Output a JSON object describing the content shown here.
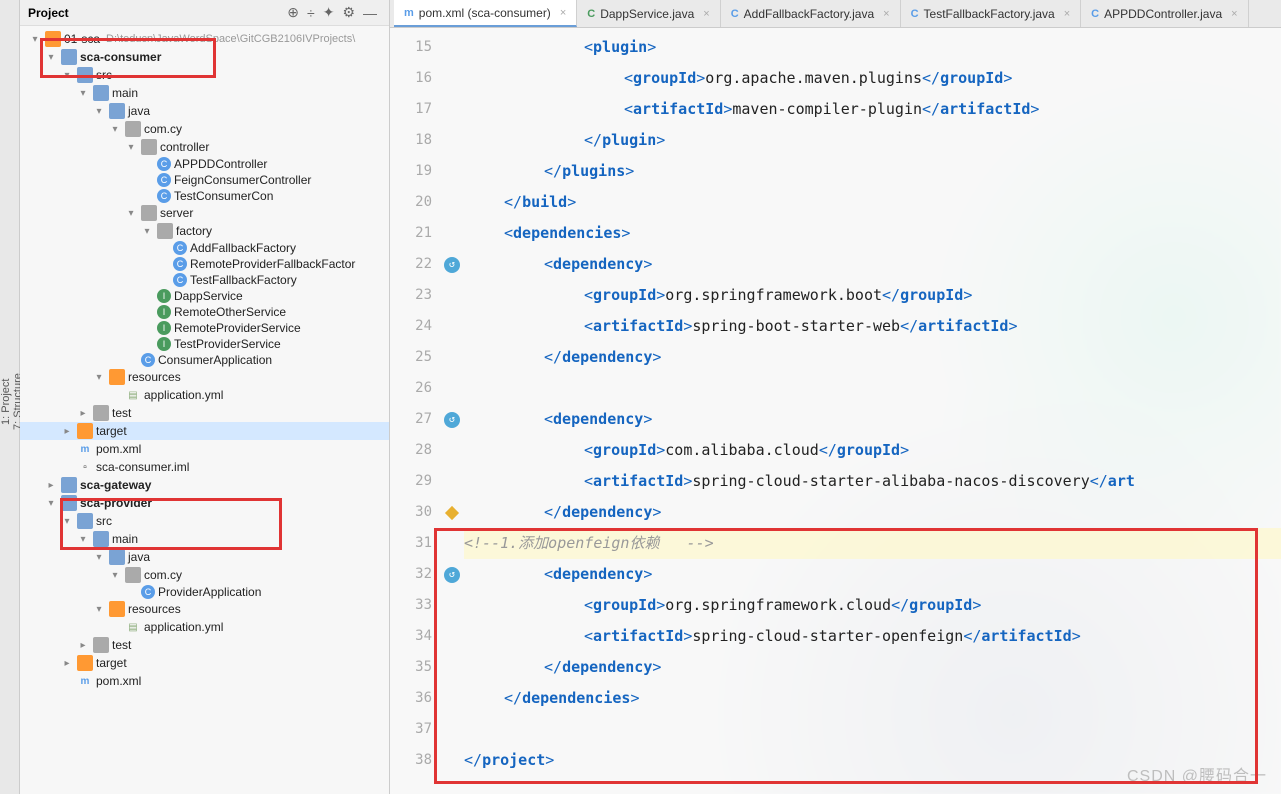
{
  "leftRail": {
    "project": "1: Project",
    "structure": "7: Structure"
  },
  "panel": {
    "title": "Project",
    "rootLabel": "01-sca",
    "rootPath": "D:\\teducn\\JavaWordSpace\\GitCGB2106IVProjects\\",
    "tree": {
      "sca_consumer": "sca-consumer",
      "src": "src",
      "main": "main",
      "java": "java",
      "com_cy": "com.cy",
      "controller": "controller",
      "appdd": "APPDDController",
      "feign": "FeignConsumerController",
      "testcon": "TestConsumerCon",
      "server": "server",
      "factory": "factory",
      "addfall": "AddFallbackFactory",
      "remotefall": "RemoteProviderFallbackFactor",
      "testfall": "TestFallbackFactory",
      "dapp": "DappService",
      "remoteother": "RemoteOtherService",
      "remoteprov": "RemoteProviderService",
      "testprov": "TestProviderService",
      "consumerapp": "ConsumerApplication",
      "resources": "resources",
      "appyml": "application.yml",
      "test": "test",
      "target": "target",
      "pomxml": "pom.xml",
      "scaiml": "sca-consumer.iml",
      "sca_gateway": "sca-gateway",
      "sca_provider": "sca-provider",
      "provapp": "ProviderApplication"
    }
  },
  "tabs": [
    {
      "icon": "m",
      "label": "pom.xml (sca-consumer)",
      "active": true,
      "iconColor": "#5a9de8"
    },
    {
      "icon": "C",
      "label": "DappService.java",
      "iconColor": "#4a9b5e"
    },
    {
      "icon": "C",
      "label": "AddFallbackFactory.java",
      "iconColor": "#5a9de8"
    },
    {
      "icon": "C",
      "label": "TestFallbackFactory.java",
      "iconColor": "#5a9de8"
    },
    {
      "icon": "C",
      "label": "APPDDController.java",
      "iconColor": "#5a9de8"
    }
  ],
  "code": {
    "startLine": 15,
    "lines": [
      {
        "n": 15,
        "indent": 12,
        "parts": [
          [
            "bracket",
            "<"
          ],
          [
            "tag",
            "plugin"
          ],
          [
            "bracket",
            ">"
          ]
        ]
      },
      {
        "n": 16,
        "indent": 16,
        "parts": [
          [
            "bracket",
            "<"
          ],
          [
            "tag",
            "groupId"
          ],
          [
            "bracket",
            ">"
          ],
          [
            "text",
            "org.apache.maven.plugins"
          ],
          [
            "bracket",
            "</"
          ],
          [
            "tag",
            "groupId"
          ],
          [
            "bracket",
            ">"
          ]
        ]
      },
      {
        "n": 17,
        "indent": 16,
        "parts": [
          [
            "bracket",
            "<"
          ],
          [
            "tag",
            "artifactId"
          ],
          [
            "bracket",
            ">"
          ],
          [
            "text",
            "maven-compiler-plugin"
          ],
          [
            "bracket",
            "</"
          ],
          [
            "tag",
            "artifactId"
          ],
          [
            "bracket",
            ">"
          ]
        ]
      },
      {
        "n": 18,
        "indent": 12,
        "parts": [
          [
            "bracket",
            "</"
          ],
          [
            "tag",
            "plugin"
          ],
          [
            "bracket",
            ">"
          ]
        ]
      },
      {
        "n": 19,
        "indent": 8,
        "parts": [
          [
            "bracket",
            "</"
          ],
          [
            "tag",
            "plugins"
          ],
          [
            "bracket",
            ">"
          ]
        ]
      },
      {
        "n": 20,
        "indent": 4,
        "parts": [
          [
            "bracket",
            "</"
          ],
          [
            "tag",
            "build"
          ],
          [
            "bracket",
            ">"
          ]
        ]
      },
      {
        "n": 21,
        "indent": 4,
        "parts": [
          [
            "bracket",
            "<"
          ],
          [
            "tag",
            "dependencies"
          ],
          [
            "bracket",
            ">"
          ]
        ]
      },
      {
        "n": 22,
        "indent": 8,
        "parts": [
          [
            "bracket",
            "<"
          ],
          [
            "tag",
            "dependency"
          ],
          [
            "bracket",
            ">"
          ]
        ],
        "gicon": "circle"
      },
      {
        "n": 23,
        "indent": 12,
        "parts": [
          [
            "bracket",
            "<"
          ],
          [
            "tag",
            "groupId"
          ],
          [
            "bracket",
            ">"
          ],
          [
            "text",
            "org.springframework.boot"
          ],
          [
            "bracket",
            "</"
          ],
          [
            "tag",
            "groupId"
          ],
          [
            "bracket",
            ">"
          ]
        ]
      },
      {
        "n": 24,
        "indent": 12,
        "parts": [
          [
            "bracket",
            "<"
          ],
          [
            "tag",
            "artifactId"
          ],
          [
            "bracket",
            ">"
          ],
          [
            "text",
            "spring-boot-starter-web"
          ],
          [
            "bracket",
            "</"
          ],
          [
            "tag",
            "artifactId"
          ],
          [
            "bracket",
            ">"
          ]
        ]
      },
      {
        "n": 25,
        "indent": 8,
        "parts": [
          [
            "bracket",
            "</"
          ],
          [
            "tag",
            "dependency"
          ],
          [
            "bracket",
            ">"
          ]
        ]
      },
      {
        "n": 26,
        "indent": 0,
        "parts": []
      },
      {
        "n": 27,
        "indent": 8,
        "parts": [
          [
            "bracket",
            "<"
          ],
          [
            "tag",
            "dependency"
          ],
          [
            "bracket",
            ">"
          ]
        ],
        "gicon": "circle"
      },
      {
        "n": 28,
        "indent": 12,
        "parts": [
          [
            "bracket",
            "<"
          ],
          [
            "tag",
            "groupId"
          ],
          [
            "bracket",
            ">"
          ],
          [
            "text",
            "com.alibaba.cloud"
          ],
          [
            "bracket",
            "</"
          ],
          [
            "tag",
            "groupId"
          ],
          [
            "bracket",
            ">"
          ]
        ]
      },
      {
        "n": 29,
        "indent": 12,
        "parts": [
          [
            "bracket",
            "<"
          ],
          [
            "tag",
            "artifactId"
          ],
          [
            "bracket",
            ">"
          ],
          [
            "text",
            "spring-cloud-starter-alibaba-nacos-discovery"
          ],
          [
            "bracket",
            "</"
          ],
          [
            "tag",
            "art"
          ]
        ]
      },
      {
        "n": 30,
        "indent": 8,
        "parts": [
          [
            "bracket",
            "</"
          ],
          [
            "tag",
            "dependency"
          ],
          [
            "bracket",
            ">"
          ]
        ],
        "gicon": "diamond"
      },
      {
        "n": 31,
        "indent": 0,
        "highlight": true,
        "parts": [
          [
            "comment",
            "<!--1.添加openfeign依赖   -->"
          ]
        ]
      },
      {
        "n": 32,
        "indent": 8,
        "parts": [
          [
            "bracket",
            "<"
          ],
          [
            "tag",
            "dependency"
          ],
          [
            "bracket",
            ">"
          ]
        ],
        "gicon": "circle"
      },
      {
        "n": 33,
        "indent": 12,
        "parts": [
          [
            "bracket",
            "<"
          ],
          [
            "tag",
            "groupId"
          ],
          [
            "bracket",
            ">"
          ],
          [
            "text",
            "org.springframework.cloud"
          ],
          [
            "bracket",
            "</"
          ],
          [
            "tag",
            "groupId"
          ],
          [
            "bracket",
            ">"
          ]
        ]
      },
      {
        "n": 34,
        "indent": 12,
        "parts": [
          [
            "bracket",
            "<"
          ],
          [
            "tag",
            "artifactId"
          ],
          [
            "bracket",
            ">"
          ],
          [
            "text",
            "spring-cloud-starter-openfeign"
          ],
          [
            "bracket",
            "</"
          ],
          [
            "tag",
            "artifactId"
          ],
          [
            "bracket",
            ">"
          ]
        ]
      },
      {
        "n": 35,
        "indent": 8,
        "parts": [
          [
            "bracket",
            "</"
          ],
          [
            "tag",
            "dependency"
          ],
          [
            "bracket",
            ">"
          ]
        ]
      },
      {
        "n": 36,
        "indent": 4,
        "parts": [
          [
            "bracket",
            "</"
          ],
          [
            "tag",
            "dependencies"
          ],
          [
            "bracket",
            ">"
          ]
        ]
      },
      {
        "n": 37,
        "indent": 0,
        "parts": []
      },
      {
        "n": 38,
        "indent": 0,
        "parts": [
          [
            "bracket",
            "</"
          ],
          [
            "tag",
            "project"
          ],
          [
            "bracket",
            ">"
          ]
        ]
      }
    ]
  },
  "watermark": "CSDN @腰码合一"
}
